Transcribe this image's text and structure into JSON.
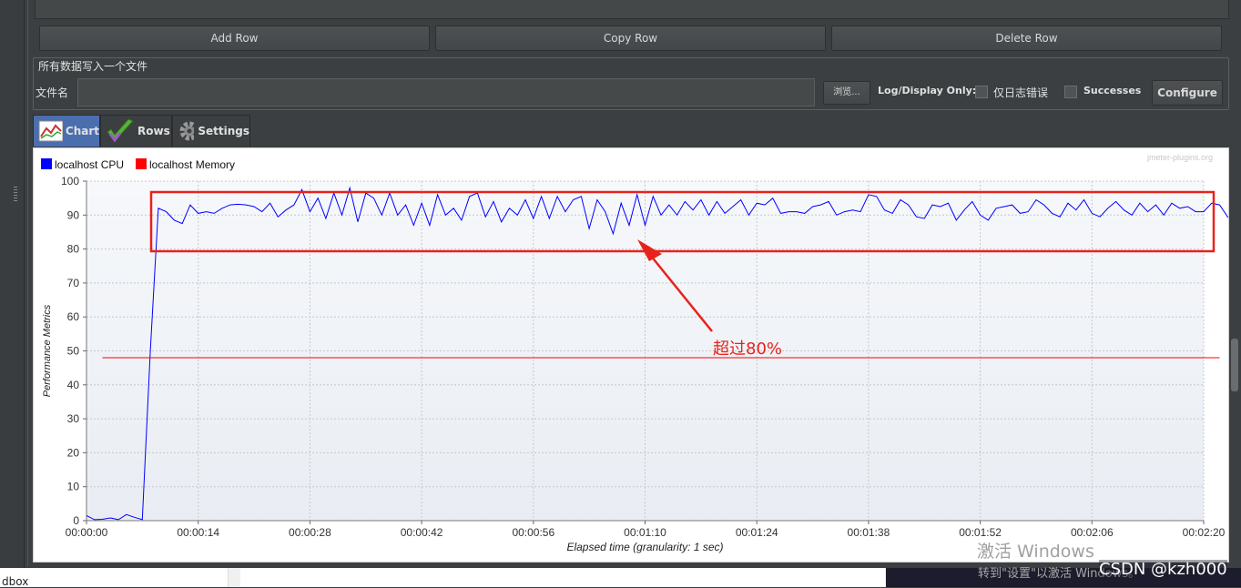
{
  "buttons": {
    "add_row": "Add Row",
    "copy_row": "Copy Row",
    "delete_row": "Delete Row"
  },
  "file_section": {
    "legend": "所有数据写入一个文件",
    "filename_label": "文件名",
    "filename_value": "",
    "browse": "浏览...",
    "log_display_label": "Log/Display Only:",
    "errors_label": "仅日志错误",
    "errors_checked": false,
    "successes_label": "Successes",
    "successes_checked": false,
    "configure": "Configure"
  },
  "tabs": [
    {
      "label": "Chart",
      "icon": "chart-icon",
      "active": true
    },
    {
      "label": "Rows",
      "icon": "checkmark-icon",
      "active": false
    },
    {
      "label": "Settings",
      "icon": "gear-icon",
      "active": false
    }
  ],
  "chart": {
    "watermark": "jmeter-plugins.org",
    "annotation": "超过80%",
    "annotation_color": "#e8221b",
    "grid": true,
    "legend_position": "top-left"
  },
  "chart_data": {
    "type": "line",
    "xlabel": "Elapsed time (granularity: 1 sec)",
    "ylabel": "Performance Metrics",
    "ylim": [
      0,
      100
    ],
    "yticks": [
      0,
      10,
      20,
      30,
      40,
      50,
      60,
      70,
      80,
      90,
      100
    ],
    "xlim_seconds": [
      0,
      140
    ],
    "xticks": [
      "00:00:00",
      "00:00:14",
      "00:00:28",
      "00:00:42",
      "00:00:56",
      "00:01:10",
      "00:01:24",
      "00:01:38",
      "00:01:52",
      "00:02:06",
      "00:02:20"
    ],
    "series": [
      {
        "name": "localhost CPU",
        "color": "#0000ff",
        "values": [
          1.5,
          0.3,
          0.4,
          0.8,
          0.3,
          1.8,
          1.0,
          0.3,
          50,
          92,
          91,
          88.5,
          87.5,
          93,
          90.5,
          91,
          90.5,
          92,
          93,
          93.2,
          93,
          92.5,
          91,
          93.5,
          89.5,
          91.5,
          93,
          97.5,
          91,
          95,
          89,
          96.5,
          90,
          98,
          88,
          96.5,
          95,
          90,
          96.5,
          90,
          93,
          87,
          93.5,
          87,
          96,
          90,
          92,
          88.5,
          95.5,
          96.5,
          89.5,
          94,
          88,
          92,
          90,
          94.5,
          89,
          95.5,
          89,
          95.5,
          91,
          94.5,
          95.5,
          86,
          94.5,
          91,
          84.5,
          93.5,
          87,
          96,
          87,
          95.5,
          90,
          93,
          90,
          94,
          91.5,
          94.5,
          90,
          94,
          90.5,
          92.5,
          94.5,
          90,
          93.5,
          93,
          95,
          90.5,
          91,
          91,
          90.5,
          92.5,
          93,
          94,
          90,
          91,
          91.5,
          91,
          96,
          95.5,
          91.5,
          90.5,
          94.5,
          93,
          89.5,
          89,
          93,
          92.5,
          93.5,
          88.5,
          91.5,
          94,
          90,
          88.5,
          92,
          92.5,
          93,
          90.5,
          91,
          94.5,
          93,
          90.5,
          89.5,
          93.5,
          91.5,
          94.5,
          90.5,
          89.5,
          92,
          94,
          91.5,
          90,
          93.5,
          91,
          93,
          90,
          93.5,
          92,
          92.5,
          91,
          91,
          93.5,
          93,
          89.5,
          88,
          92,
          89
        ]
      },
      {
        "name": "localhost Memory",
        "color": "#ff0000",
        "values": [
          48,
          48,
          48,
          48,
          48,
          48,
          48,
          48,
          48,
          48,
          48,
          48,
          48,
          48,
          48,
          48,
          48,
          48,
          48,
          48,
          48,
          48,
          48,
          48,
          48,
          48,
          48,
          48,
          48,
          48,
          48,
          48,
          48,
          48,
          48,
          48,
          48,
          48,
          48,
          48,
          48,
          48,
          48,
          48,
          48,
          48,
          48,
          48,
          48,
          48,
          48,
          48,
          48,
          48,
          48,
          48,
          48,
          48,
          48,
          48,
          48,
          48,
          48,
          48,
          48,
          48,
          48,
          48,
          48,
          48,
          48,
          48,
          48,
          48,
          48,
          48,
          48,
          48,
          48,
          48,
          48,
          48,
          48,
          48,
          48,
          48,
          48,
          48,
          48,
          48,
          48,
          48,
          48,
          48,
          48,
          48,
          48,
          48,
          48,
          48,
          48,
          48,
          48,
          48,
          48,
          48,
          48,
          48,
          48,
          48,
          48,
          48,
          48,
          48,
          48,
          48,
          48,
          48,
          48,
          48,
          48,
          48,
          48,
          48,
          48,
          48,
          48,
          48,
          48,
          48,
          48,
          48,
          48,
          48,
          48,
          48,
          48,
          48,
          48,
          48,
          48
        ],
        "x_start_seconds": 2
      }
    ]
  },
  "overlay": {
    "activate_title": "激活 Windows",
    "activate_sub": "转到\"设置\"以激活 Windows。",
    "csdn": "CSDN @kzh000",
    "bottom_left": "dbox"
  }
}
